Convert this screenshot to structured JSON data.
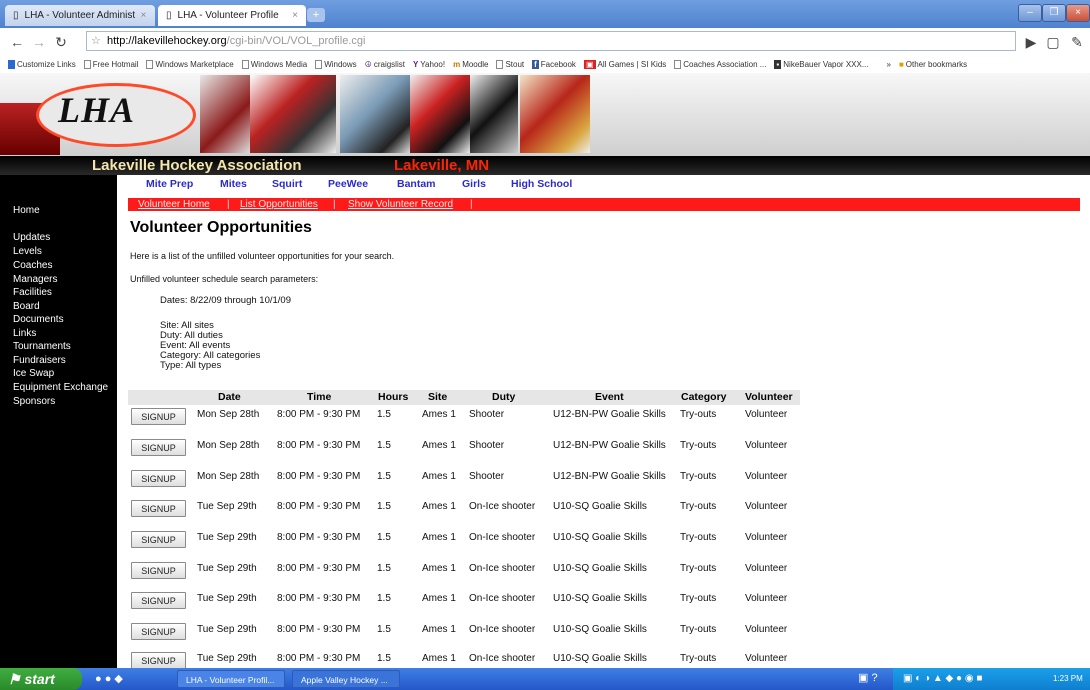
{
  "browser": {
    "tabs": [
      {
        "label": "LHA - Volunteer Administrator"
      },
      {
        "label": "LHA - Volunteer Profile"
      }
    ],
    "new_tab": "+",
    "url_host": "http://lakevillehockey.org",
    "url_path": "/cgi-bin/VOL/VOL_profile.cgi",
    "bookmarks": [
      "Customize Links",
      "Free Hotmail",
      "Windows Marketplace",
      "Windows Media",
      "Windows",
      "craigslist",
      "Yahoo!",
      "Moodle",
      "Stout",
      "Facebook",
      "All Games | SI Kids",
      "Coaches Association ...",
      "NikeBauer Vapor XXX..."
    ],
    "other_bookmarks": "Other bookmarks"
  },
  "site": {
    "logo": "LHA",
    "title": "Lakeville Hockey Association",
    "location": "Lakeville, MN",
    "levels": [
      "Mite Prep",
      "Mites",
      "Squirt",
      "PeeWee",
      "Bantam",
      "Girls",
      "High School"
    ],
    "sidebar": [
      "Home",
      "Updates",
      "Levels",
      "Coaches",
      "Managers",
      "Facilities",
      "Board",
      "Documents",
      "Links",
      "Tournaments",
      "Fundraisers",
      "Ice Swap",
      "Equipment Exchange",
      "Sponsors"
    ],
    "volunteer_nav": [
      "Volunteer Home",
      "List Opportunities",
      "Show Volunteer Record"
    ]
  },
  "main": {
    "heading": "Volunteer Opportunities",
    "intro": "Here is a list of the unfilled volunteer opportunities for your search.",
    "params_label": "Unfilled volunteer schedule search parameters:",
    "dates": "Dates: 8/22/09 through 10/1/09",
    "site": "Site: All sites",
    "duty": "Duty: All duties",
    "event": "Event: All events",
    "category": "Category: All categories",
    "type": "Type: All types"
  },
  "table": {
    "headers": [
      "Date",
      "Time",
      "Hours",
      "Site",
      "Duty",
      "Event",
      "Category",
      "Volunteer"
    ],
    "signup_label": "SIGNUP",
    "rows": [
      {
        "date": "Mon Sep 28th",
        "time": "8:00 PM - 9:30 PM",
        "hours": "1.5",
        "site": "Ames 1",
        "duty": "Shooter",
        "event": "U12-BN-PW Goalie Skills",
        "category": "Try-outs",
        "volunteer": "Volunteer"
      },
      {
        "date": "Mon Sep 28th",
        "time": "8:00 PM - 9:30 PM",
        "hours": "1.5",
        "site": "Ames 1",
        "duty": "Shooter",
        "event": "U12-BN-PW Goalie Skills",
        "category": "Try-outs",
        "volunteer": "Volunteer"
      },
      {
        "date": "Mon Sep 28th",
        "time": "8:00 PM - 9:30 PM",
        "hours": "1.5",
        "site": "Ames 1",
        "duty": "Shooter",
        "event": "U12-BN-PW Goalie Skills",
        "category": "Try-outs",
        "volunteer": "Volunteer"
      },
      {
        "date": "Tue Sep 29th",
        "time": "8:00 PM - 9:30 PM",
        "hours": "1.5",
        "site": "Ames 1",
        "duty": "On-Ice shooter",
        "event": "U10-SQ Goalie Skills",
        "category": "Try-outs",
        "volunteer": "Volunteer"
      },
      {
        "date": "Tue Sep 29th",
        "time": "8:00 PM - 9:30 PM",
        "hours": "1.5",
        "site": "Ames 1",
        "duty": "On-Ice shooter",
        "event": "U10-SQ Goalie Skills",
        "category": "Try-outs",
        "volunteer": "Volunteer"
      },
      {
        "date": "Tue Sep 29th",
        "time": "8:00 PM - 9:30 PM",
        "hours": "1.5",
        "site": "Ames 1",
        "duty": "On-Ice shooter",
        "event": "U10-SQ Goalie Skills",
        "category": "Try-outs",
        "volunteer": "Volunteer"
      },
      {
        "date": "Tue Sep 29th",
        "time": "8:00 PM - 9:30 PM",
        "hours": "1.5",
        "site": "Ames 1",
        "duty": "On-Ice shooter",
        "event": "U10-SQ Goalie Skills",
        "category": "Try-outs",
        "volunteer": "Volunteer"
      },
      {
        "date": "Tue Sep 29th",
        "time": "8:00 PM - 9:30 PM",
        "hours": "1.5",
        "site": "Ames 1",
        "duty": "On-Ice shooter",
        "event": "U10-SQ Goalie Skills",
        "category": "Try-outs",
        "volunteer": "Volunteer"
      },
      {
        "date": "Tue Sep 29th",
        "time": "8:00 PM - 9:30 PM",
        "hours": "1.5",
        "site": "Ames 1",
        "duty": "On-Ice shooter",
        "event": "U10-SQ Goalie Skills",
        "category": "Try-outs",
        "volunteer": "Volunteer"
      }
    ]
  },
  "taskbar": {
    "start": "start",
    "tasks": [
      "LHA - Volunteer Profil...",
      "Apple Valley Hockey ..."
    ],
    "clock": "1:23 PM"
  }
}
